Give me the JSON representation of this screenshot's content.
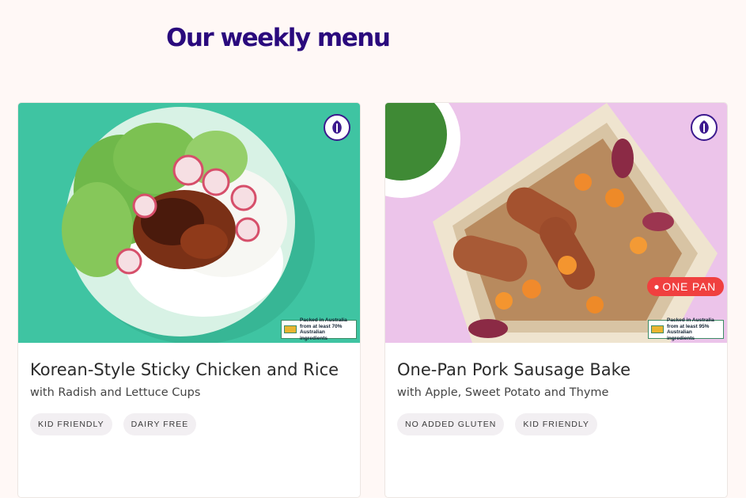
{
  "page": {
    "title": "Our weekly menu"
  },
  "cards": [
    {
      "title": "Korean-Style Sticky Chicken and Rice",
      "subtitle": "with Radish and Lettuce Cups",
      "tags": [
        "KID FRIENDLY",
        "DAIRY FREE"
      ],
      "packed": [
        "Packed in Australia",
        "from at least 70%",
        "Australian ingredients"
      ],
      "bg_color": "#3fc4a2"
    },
    {
      "title": "One-Pan Pork Sausage Bake",
      "subtitle": "with Apple, Sweet Potato and Thyme",
      "tags": [
        "NO ADDED GLUTEN",
        "KID FRIENDLY"
      ],
      "badge": "ONE PAN",
      "packed": [
        "Packed in Australia",
        "from at least 95%",
        "Australian ingredients"
      ],
      "bg_color": "#ecc4ea"
    }
  ],
  "colors": {
    "title": "#2a0a7d",
    "one_pan_badge": "#f0403f"
  },
  "icons": {
    "vegetable_badge": "veg-logo-icon",
    "one_pan_badge": "magnifier-icon"
  }
}
